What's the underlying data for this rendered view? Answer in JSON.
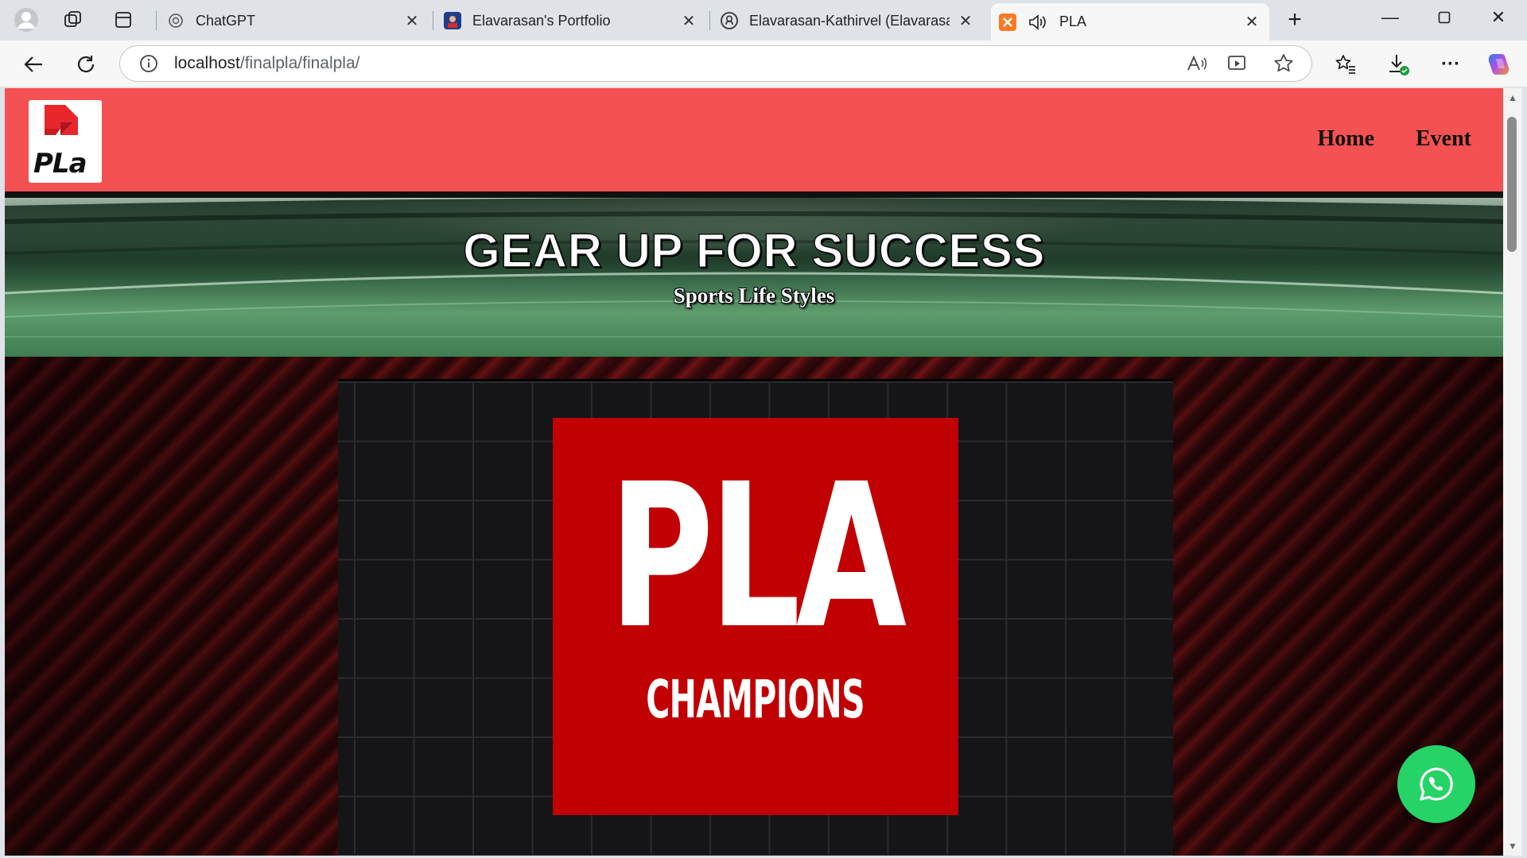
{
  "browser": {
    "tabs": [
      {
        "title": "ChatGPT",
        "icon": "chatgpt-icon"
      },
      {
        "title": "Elavarasan's Portfolio",
        "icon": "portrait-icon"
      },
      {
        "title": "Elavarasan-Kathirvel (Elavarasan",
        "icon": "github-icon"
      },
      {
        "title": "PLA",
        "icon": "xampp-icon",
        "active": true,
        "audio": true
      }
    ],
    "address": {
      "host": "localhost",
      "path": "/finalpla/finalpla/"
    }
  },
  "site": {
    "logo_text": "PLa",
    "nav": {
      "home": "Home",
      "event": "Event"
    },
    "hero": {
      "title": "GEAR UP FOR SUCCESS",
      "subtitle": "Sports Life Styles"
    },
    "poster": {
      "title": "PLA",
      "subtitle": "CHAMPIONS"
    },
    "colors": {
      "header": "#f45152",
      "poster": "#c10003",
      "whatsapp": "#25d366"
    }
  }
}
